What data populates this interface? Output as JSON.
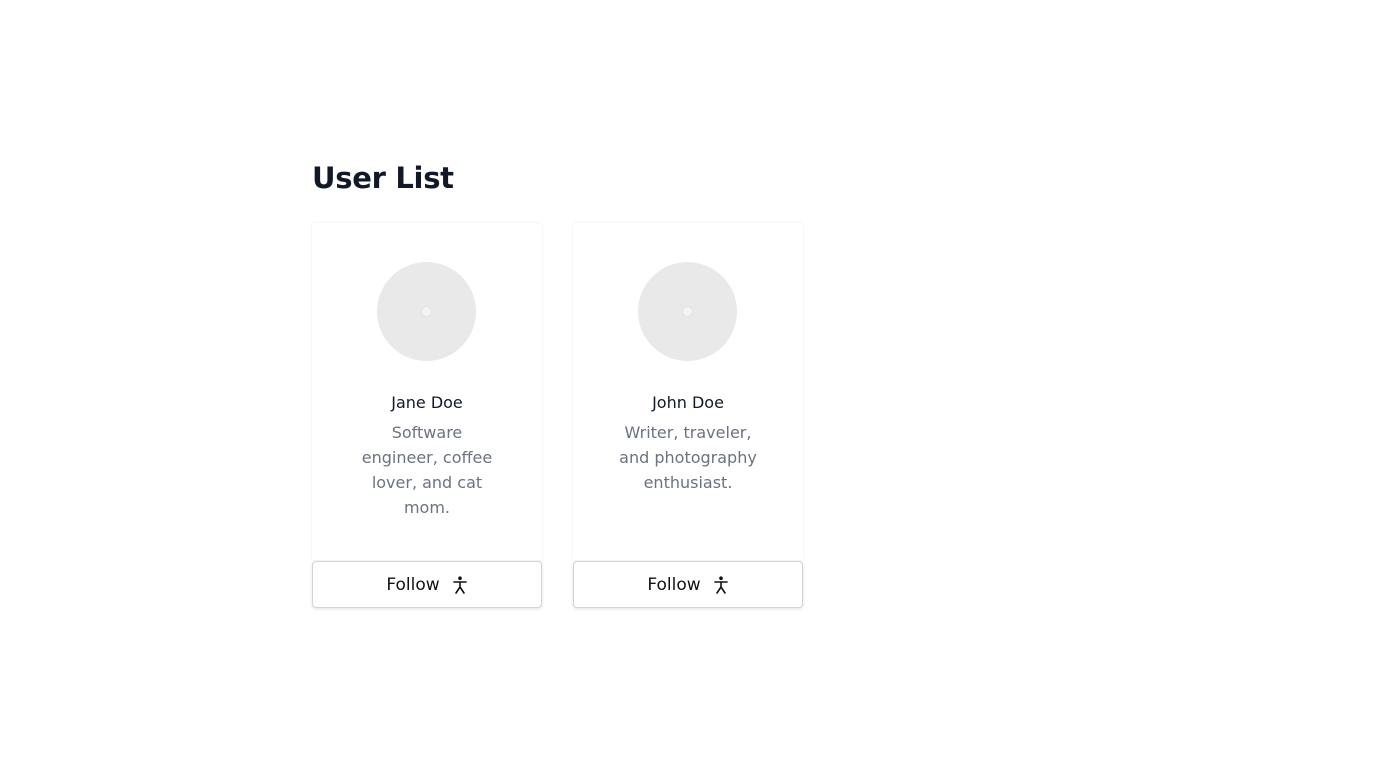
{
  "page": {
    "title": "User List"
  },
  "users": [
    {
      "name": "Jane Doe",
      "bio": "Software engineer, coffee lover, and cat mom.",
      "follow_label": "Follow",
      "avatar_icon": "avatar-placeholder-icon",
      "follow_icon": "accessibility-person-icon"
    },
    {
      "name": "John Doe",
      "bio": "Writer, traveler, and photography enthusiast.",
      "follow_label": "Follow",
      "avatar_icon": "avatar-placeholder-icon",
      "follow_icon": "accessibility-person-icon"
    }
  ]
}
